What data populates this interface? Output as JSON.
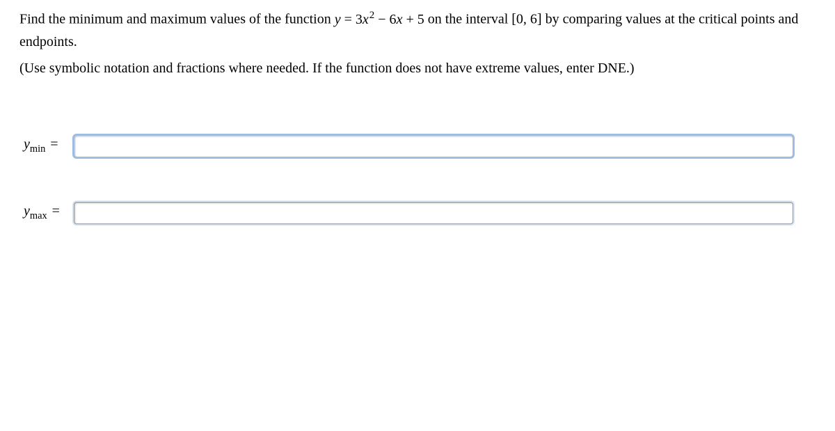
{
  "question": {
    "line1_pre": "Find the minimum and maximum values of the function ",
    "eq_y": "y",
    "eq_eq": " = ",
    "eq_rhs_a": "3",
    "eq_rhs_x": "x",
    "eq_rhs_exp": "2",
    "eq_rhs_b": " − 6",
    "eq_rhs_x2": "x",
    "eq_rhs_c": " + 5",
    "line1_post": " on the interval [0, 6] by comparing values at the critical points and endpoints.",
    "line2": "(Use symbolic notation and fractions where needed. If the function does not have extreme values, enter DNE.)"
  },
  "inputs": {
    "ymin": {
      "label_var": "y",
      "label_sub": "min",
      "equals": " =",
      "value": ""
    },
    "ymax": {
      "label_var": "y",
      "label_sub": "max",
      "equals": " =",
      "value": ""
    }
  }
}
